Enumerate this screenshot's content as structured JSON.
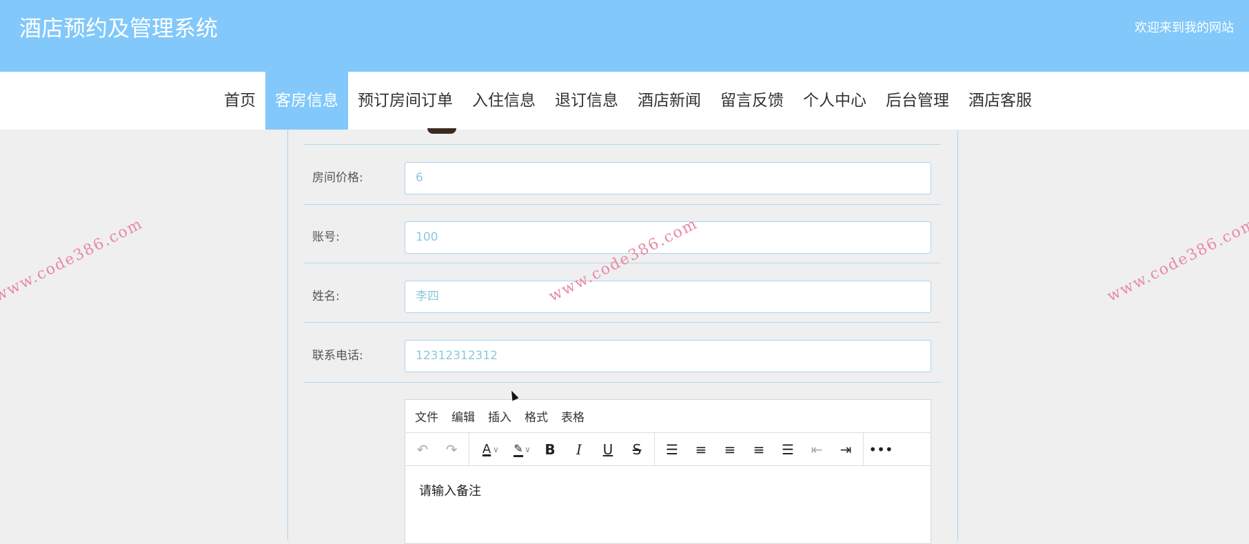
{
  "header": {
    "title": "酒店预约及管理系统",
    "welcome": "欢迎来到我的网站"
  },
  "nav": {
    "items": [
      "首页",
      "客房信息",
      "预订房间订单",
      "入住信息",
      "退订信息",
      "酒店新闻",
      "留言反馈",
      "个人中心",
      "后台管理",
      "酒店客服"
    ],
    "active": 1
  },
  "form": {
    "fields": [
      {
        "label": "房间价格:",
        "value": "6"
      },
      {
        "label": "账号:",
        "value": "100"
      },
      {
        "label": "姓名:",
        "value": "李四"
      },
      {
        "label": "联系电话:",
        "value": "12312312312"
      }
    ],
    "editor": {
      "menus": [
        "文件",
        "编辑",
        "插入",
        "格式",
        "表格"
      ],
      "placeholder": "请输入备注"
    }
  },
  "watermark": "www.code386.com",
  "colors": {
    "accent": "#82c8fa",
    "input_text": "#8cc8e0",
    "border": "#a9d4ef"
  }
}
